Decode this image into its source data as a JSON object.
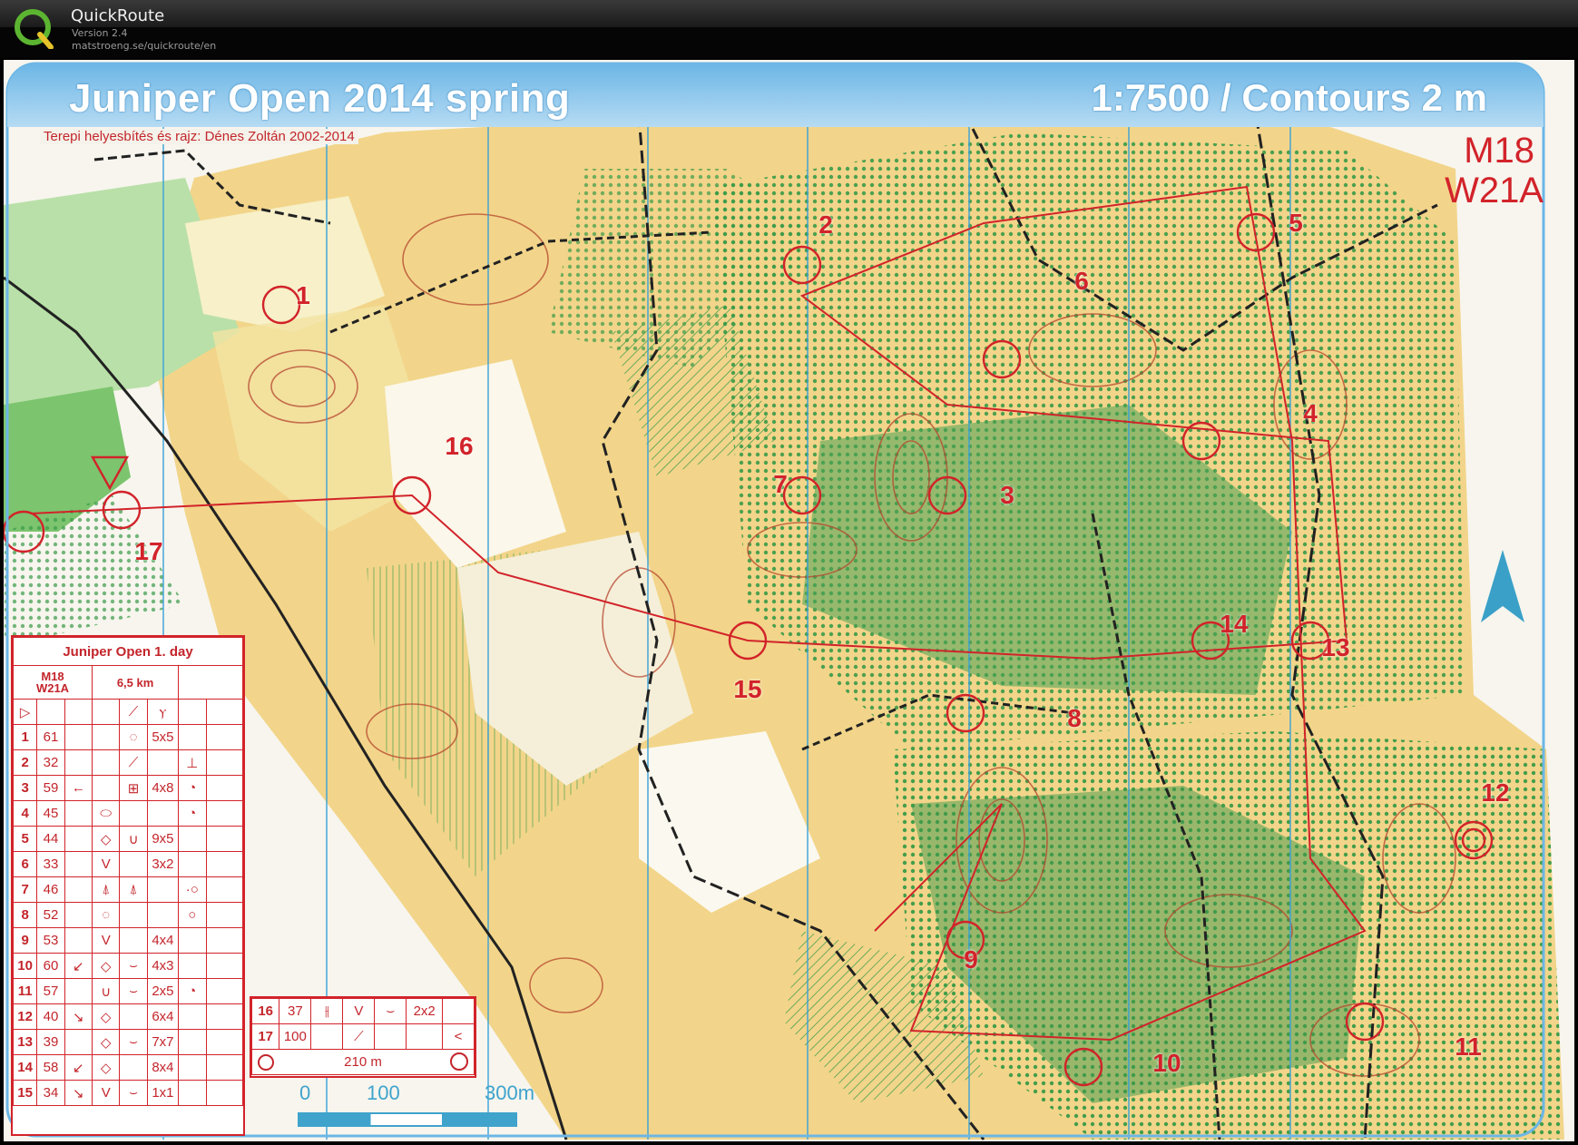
{
  "app": {
    "name": "QuickRoute",
    "version": "Version 2.4",
    "url": "matstroeng.se/quickroute/en"
  },
  "map": {
    "title": "Juniper Open 2014 spring",
    "scale_text": "1:7500 / Contours 2 m",
    "credit": "Terepi helyesbítés és rajz: Dénes Zoltán 2002-2014",
    "classes": [
      "M18",
      "W21A"
    ],
    "colors": {
      "course": "#d2232a",
      "header_blue": "#6cb6e6",
      "vegetation_green": "#3a9a48",
      "open_yellow": "#f2c64f",
      "north_arrow": "#3aa0c8"
    },
    "controls": [
      {
        "label": "1"
      },
      {
        "label": "2"
      },
      {
        "label": "3"
      },
      {
        "label": "4"
      },
      {
        "label": "5"
      },
      {
        "label": "6"
      },
      {
        "label": "7"
      },
      {
        "label": "8"
      },
      {
        "label": "9"
      },
      {
        "label": "10"
      },
      {
        "label": "11"
      },
      {
        "label": "12"
      },
      {
        "label": "13"
      },
      {
        "label": "14"
      },
      {
        "label": "15"
      },
      {
        "label": "16"
      },
      {
        "label": "17"
      }
    ]
  },
  "description_sheet": {
    "title": "Juniper Open 1. day",
    "class_top": "M18",
    "class_bottom": "W21A",
    "length": "6,5 km",
    "rows": [
      {
        "n": "1",
        "code": "61",
        "c": "",
        "d": "",
        "e": "◌",
        "f": "5x5",
        "g": ""
      },
      {
        "n": "2",
        "code": "32",
        "c": "",
        "d": "",
        "e": "⟋",
        "f": "",
        "g": "⊥"
      },
      {
        "n": "3",
        "code": "59",
        "c": "←",
        "d": "",
        "e": "⊞",
        "f": "4x8",
        "g": "◔"
      },
      {
        "n": "4",
        "code": "45",
        "c": "",
        "d": "⬭",
        "e": "",
        "f": "",
        "g": "◔"
      },
      {
        "n": "5",
        "code": "44",
        "c": "",
        "d": "◇",
        "e": "∪",
        "f": "9x5",
        "g": ""
      },
      {
        "n": "6",
        "code": "33",
        "c": "",
        "d": "V",
        "e": "",
        "f": "3x2",
        "g": ""
      },
      {
        "n": "7",
        "code": "46",
        "c": "",
        "d": "⍋",
        "e": "⍋",
        "f": "",
        "g": "·○"
      },
      {
        "n": "8",
        "code": "52",
        "c": "",
        "d": "◌",
        "e": "",
        "f": "",
        "g": "○"
      },
      {
        "n": "9",
        "code": "53",
        "c": "",
        "d": "V",
        "e": "",
        "f": "4x4",
        "g": ""
      },
      {
        "n": "10",
        "code": "60",
        "c": "↙",
        "d": "◇",
        "e": "⌣",
        "f": "4x3",
        "g": ""
      },
      {
        "n": "11",
        "code": "57",
        "c": "",
        "d": "∪",
        "e": "⌣",
        "f": "2x5",
        "g": "◔"
      },
      {
        "n": "12",
        "code": "40",
        "c": "↘",
        "d": "◇",
        "e": "",
        "f": "6x4",
        "g": ""
      },
      {
        "n": "13",
        "code": "39",
        "c": "",
        "d": "◇",
        "e": "⌣",
        "f": "7x7",
        "g": ""
      },
      {
        "n": "14",
        "code": "58",
        "c": "↙",
        "d": "◇",
        "e": "",
        "f": "8x4",
        "g": ""
      },
      {
        "n": "15",
        "code": "34",
        "c": "↘",
        "d": "V",
        "e": "⌣",
        "f": "1x1",
        "g": ""
      }
    ],
    "rows2": [
      {
        "n": "16",
        "code": "37",
        "c": "⫲",
        "d": "V",
        "e": "⌣",
        "f": "2x2",
        "g": ""
      },
      {
        "n": "17",
        "code": "100",
        "c": "",
        "d": "⟋",
        "e": "",
        "f": "",
        "g": "<"
      }
    ],
    "finish_distance": "210 m"
  },
  "scalebar": {
    "labels": [
      "0",
      "100",
      "300m"
    ]
  }
}
